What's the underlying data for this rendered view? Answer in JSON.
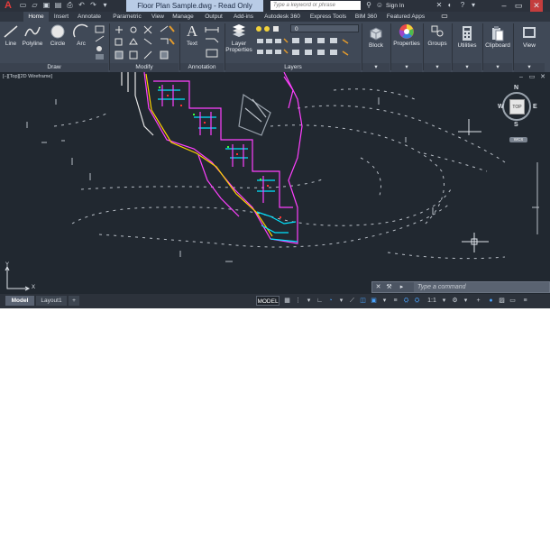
{
  "titlebar": {
    "app_logo": "A",
    "document_title": "Floor Plan Sample.dwg - Read Only",
    "search_placeholder": "Type a keyword or phrase",
    "sign_in": "Sign In",
    "help": "?",
    "qat_icons": [
      "new-icon",
      "open-icon",
      "save-icon",
      "saveas-icon",
      "print-icon",
      "undo-icon",
      "redo-icon",
      "dropdown-icon"
    ]
  },
  "ribbon_tabs": [
    "Home",
    "Insert",
    "Annotate",
    "Parametric",
    "View",
    "Manage",
    "Output",
    "Add-ins",
    "Autodesk 360",
    "Express Tools",
    "BIM 360",
    "Featured Apps"
  ],
  "active_tab": "Home",
  "ribbon": {
    "draw": {
      "label": "Draw",
      "tools": [
        "Line",
        "Polyline",
        "Circle",
        "Arc"
      ]
    },
    "modify": {
      "label": "Modify"
    },
    "annotation": {
      "label": "Annotation",
      "text_tool": "Text"
    },
    "layers": {
      "label": "Layers",
      "layer_properties": "Layer\nProperties",
      "current_layer": "0"
    },
    "block": "Block",
    "properties": "Properties",
    "groups": "Groups",
    "utilities": "Utilities",
    "clipboard": "Clipboard",
    "view": "View"
  },
  "viewport": {
    "label": "[–][Top][2D Wireframe]",
    "viewcube": {
      "n": "N",
      "s": "S",
      "e": "E",
      "w": "W",
      "face": "TOP",
      "wcs": "WCS"
    },
    "ucs": {
      "x": "X",
      "y": "Y"
    }
  },
  "command_line": {
    "placeholder": "Type a command"
  },
  "layout_tabs": [
    "Model",
    "Layout1"
  ],
  "add_layout": "+",
  "statusbar": {
    "model": "MODEL",
    "scale": "1:1"
  },
  "colors": {
    "accent": "#4aa4ff",
    "title_bg": "#b9cce6",
    "ribbon_bg": "#404957",
    "canvas_bg": "#212830"
  }
}
